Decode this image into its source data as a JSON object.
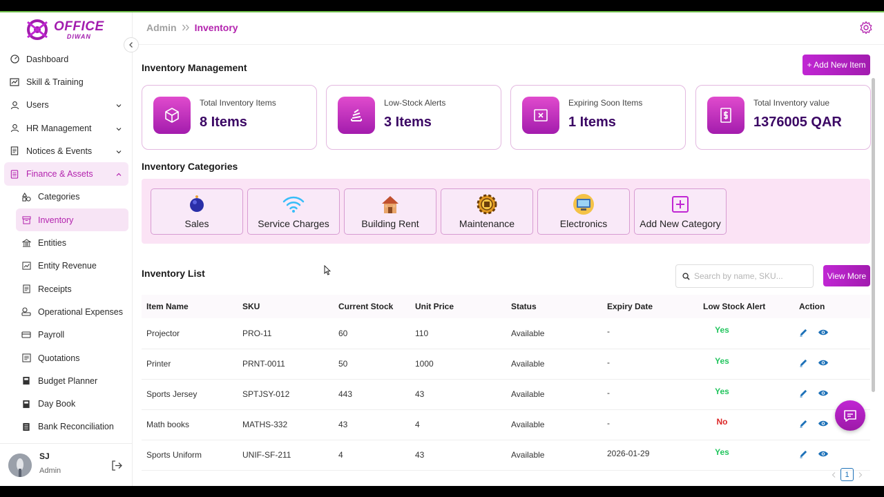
{
  "brand": {
    "line1": "OFFICE",
    "line2": "DIWAN"
  },
  "sidebar": {
    "items": [
      {
        "label": "Dashboard",
        "icon": "dashboard-icon"
      },
      {
        "label": "Skill & Training",
        "icon": "training-icon"
      },
      {
        "label": "Users",
        "icon": "user-icon",
        "expandable": true
      },
      {
        "label": "HR Management",
        "icon": "hr-icon",
        "expandable": true
      },
      {
        "label": "Notices & Events",
        "icon": "notice-icon",
        "expandable": true
      },
      {
        "label": "Finance & Assets",
        "icon": "finance-icon",
        "expandable": true,
        "open": true
      }
    ],
    "sub_items": [
      {
        "label": "Categories",
        "icon": "shapes-icon"
      },
      {
        "label": "Inventory",
        "icon": "archive-icon",
        "active": true
      },
      {
        "label": "Entities",
        "icon": "building-icon"
      },
      {
        "label": "Entity Revenue",
        "icon": "revenue-icon"
      },
      {
        "label": "Receipts",
        "icon": "receipt-icon"
      },
      {
        "label": "Operational Expenses",
        "icon": "coins-icon"
      },
      {
        "label": "Payroll",
        "icon": "payroll-icon"
      },
      {
        "label": "Quotations",
        "icon": "quotation-icon"
      },
      {
        "label": "Budget Planner",
        "icon": "budget-icon"
      },
      {
        "label": "Day Book",
        "icon": "daybook-icon"
      },
      {
        "label": "Bank Reconciliation",
        "icon": "bank-icon"
      }
    ],
    "user": {
      "name": "SJ",
      "role": "Admin"
    }
  },
  "breadcrumb": {
    "root": "Admin",
    "current": "Inventory"
  },
  "page": {
    "title": "Inventory Management",
    "add_button": "+ Add New Item",
    "stats": [
      {
        "label": "Total Inventory Items",
        "value": "8 Items",
        "icon": "cube-icon"
      },
      {
        "label": "Low-Stock Alerts",
        "value": "3 Items",
        "icon": "stack-icon"
      },
      {
        "label": "Expiring Soon Items",
        "value": "1 Items",
        "icon": "x-box-icon"
      },
      {
        "label": "Total Inventory value",
        "value": "1376005 QAR",
        "icon": "currency-icon"
      }
    ],
    "categories_title": "Inventory Categories",
    "categories": [
      {
        "label": "Sales",
        "icon": "sales-icon"
      },
      {
        "label": "Service Charges",
        "icon": "wifi-icon"
      },
      {
        "label": "Building Rent",
        "icon": "house-icon"
      },
      {
        "label": "Maintenance",
        "icon": "gear-chip-icon"
      },
      {
        "label": "Electronics",
        "icon": "electronics-icon"
      },
      {
        "label": "Add New Category",
        "icon": "plus-square-icon"
      }
    ],
    "list_title": "Inventory List",
    "search_placeholder": "Search by name, SKU...",
    "view_more": "View More",
    "table": {
      "headers": [
        "Item Name",
        "SKU",
        "Current Stock",
        "Unit Price",
        "Status",
        "Expiry Date",
        "Low Stock Alert",
        "Action"
      ],
      "rows": [
        {
          "name": "Projector",
          "sku": "PRO-11",
          "stock": "60",
          "price": "110",
          "status": "Available",
          "expiry": "-",
          "alert": "Yes"
        },
        {
          "name": "Printer",
          "sku": "PRNT-0011",
          "stock": "50",
          "price": "1000",
          "status": "Available",
          "expiry": "-",
          "alert": "Yes"
        },
        {
          "name": "Sports Jersey",
          "sku": "SPTJSY-012",
          "stock": "443",
          "price": "43",
          "status": "Available",
          "expiry": "-",
          "alert": "Yes"
        },
        {
          "name": "Math books",
          "sku": "MATHS-332",
          "stock": "43",
          "price": "4",
          "status": "Available",
          "expiry": "-",
          "alert": "No"
        },
        {
          "name": "Sports Uniform",
          "sku": "UNIF-SF-211",
          "stock": "4",
          "price": "43",
          "status": "Available",
          "expiry": "2026-01-29",
          "alert": "Yes"
        }
      ]
    },
    "pagination": {
      "current": "1"
    }
  },
  "colors": {
    "accent": "#b323ae",
    "yes": "#22c55e",
    "no": "#dc2626",
    "action_icon": "#1d71b8"
  }
}
